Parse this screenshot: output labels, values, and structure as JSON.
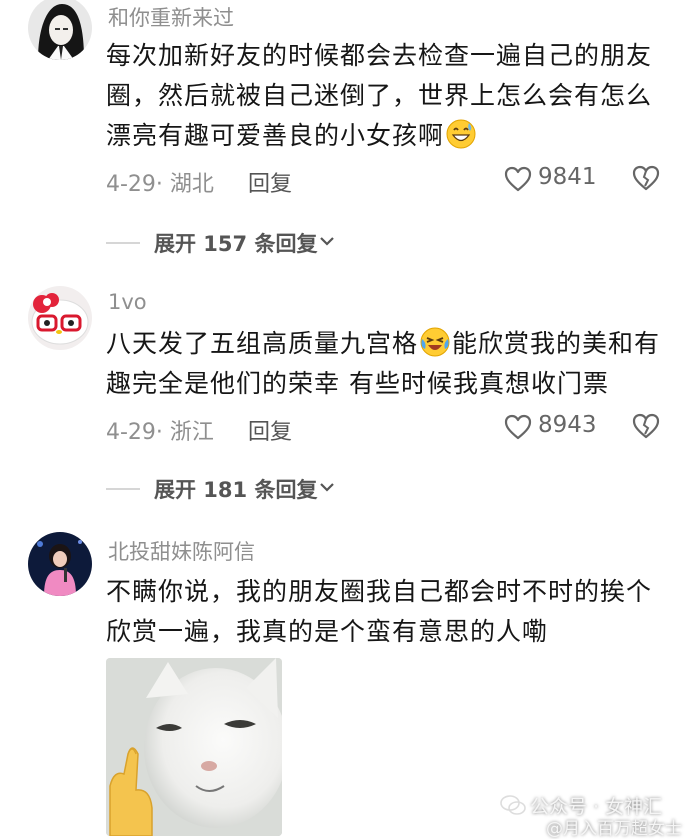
{
  "comments": [
    {
      "username": "和你重新来过",
      "text_lines": [
        "每次加新好友的时候都会去检查一遍自己的朋友",
        "圈，然后就被自己迷倒了，世界上怎么会有怎么",
        "漂亮有趣可爱善良的小女孩啊"
      ],
      "emoji": "grinning-sweat-emoji",
      "date": "4-29· 湖北",
      "reply_label": "回复",
      "likes": "9841",
      "expand_label": "展开 157 条回复"
    },
    {
      "username": "1vo",
      "text_line1_a": "八天发了五组高质量九宫格",
      "text_line1_b": "能欣赏我的美和有",
      "text_line2": "趣完全是他们的荣幸 有些时候我真想收门票",
      "emoji": "laughing-crying-emoji",
      "date": "4-29· 浙江",
      "reply_label": "回复",
      "likes": "8943",
      "expand_label": "展开 181 条回复"
    },
    {
      "username": "北投甜妹陈阿信",
      "text_lines": [
        "不瞒你说，我的朋友圈我自己都会时不时的挨个",
        "欣赏一遍，我真的是个蛮有意思的人嘞"
      ],
      "image": "smug-cat-pointing-image"
    }
  ],
  "watermark": {
    "line1": "公众号 · 女神汇",
    "line2": "@月入百万超女士"
  },
  "icons": {
    "like": "heart-outline-icon",
    "dislike": "broken-heart-icon",
    "expand": "chevron-down-icon"
  },
  "colors": {
    "text": "#161616",
    "muted": "#8f8f8f",
    "background": "#ffffff"
  }
}
